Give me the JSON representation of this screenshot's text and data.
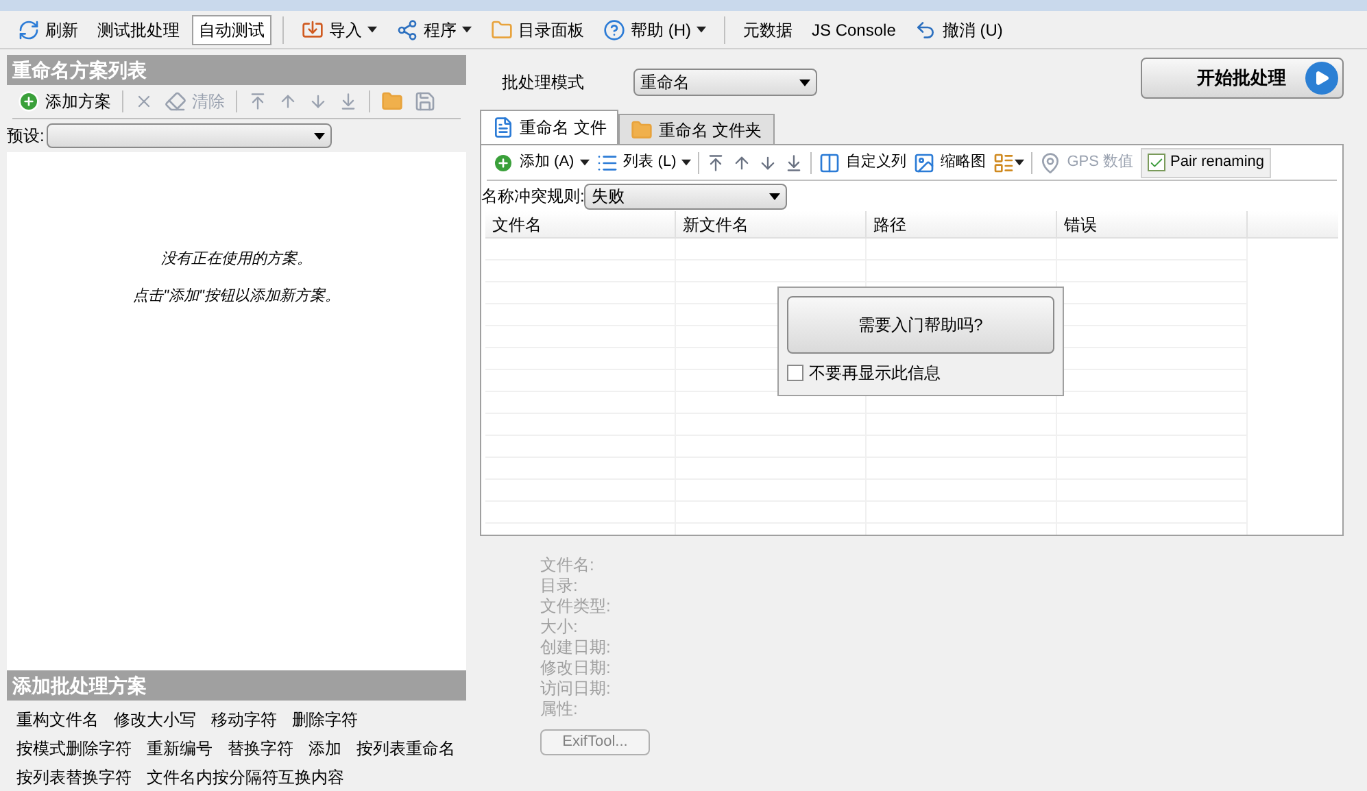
{
  "toolbar": [
    {
      "label": "刷新",
      "kind": "button",
      "pressed": false,
      "separator_before": false
    },
    {
      "label": "测试批处理",
      "kind": "button",
      "pressed": false,
      "separator_before": false
    },
    {
      "label": "自动测试",
      "kind": "toggle",
      "pressed": true,
      "separator_before": false
    },
    {
      "label": "导入",
      "kind": "menu",
      "pressed": false,
      "separator_before": true
    },
    {
      "label": "程序",
      "kind": "menu",
      "pressed": false,
      "separator_before": false
    },
    {
      "label": "目录面板",
      "kind": "button",
      "pressed": false,
      "separator_before": false
    },
    {
      "label": "帮助 (H)",
      "kind": "menu",
      "pressed": false,
      "separator_before": false
    },
    {
      "label": "元数据",
      "kind": "button",
      "pressed": false,
      "separator_before": true
    },
    {
      "label": "JS Console",
      "kind": "button",
      "pressed": false,
      "separator_before": false
    },
    {
      "label": "撤消 (U)",
      "kind": "button",
      "pressed": false,
      "separator_before": false
    }
  ],
  "scheme_list": {
    "title": "重命名方案列表",
    "add_label": "添加方案",
    "clear_label": "清除",
    "clear_disabled": true,
    "preset_label": "预设:",
    "empty_lines": [
      "没有正在使用的方案。",
      "点击\"添加\"按钮以添加新方案。"
    ]
  },
  "add_rules": {
    "title": "添加批处理方案",
    "rows": [
      [
        "重构文件名",
        "修改大小写",
        "移动字符",
        "删除字符"
      ],
      [
        "按模式删除字符",
        "重新编号",
        "替换字符",
        "添加",
        "按列表重命名"
      ],
      [
        "按列表替换字符",
        "文件名内按分隔符互换内容"
      ]
    ]
  },
  "mode": {
    "label": "批处理模式",
    "value": "重命名"
  },
  "start_button": "开始批处理",
  "tabs": [
    {
      "label": "重命名 文件",
      "selected": true
    },
    {
      "label": "重命名 文件夹",
      "selected": false
    }
  ],
  "file_toolbar": {
    "add": "添加 (A)",
    "list": "列表 (L)",
    "columns": "自定义列",
    "thumbnails": "缩略图",
    "gps": "GPS 数值",
    "gps_disabled": true,
    "pair": "Pair renaming",
    "pair_checked": true
  },
  "conflict": {
    "label": "名称冲突规则:",
    "value": "失败"
  },
  "table": {
    "columns": [
      "文件名",
      "新文件名",
      "路径",
      "错误"
    ]
  },
  "help_popup": {
    "button": "需要入门帮助吗?",
    "checkbox": "不要再显示此信息",
    "checked": false
  },
  "file_info": [
    "文件名:",
    "目录:",
    "文件类型:",
    "大小:",
    "创建日期:",
    "修改日期:",
    "访问日期:",
    "属性:"
  ],
  "exif_button": "ExifTool..."
}
